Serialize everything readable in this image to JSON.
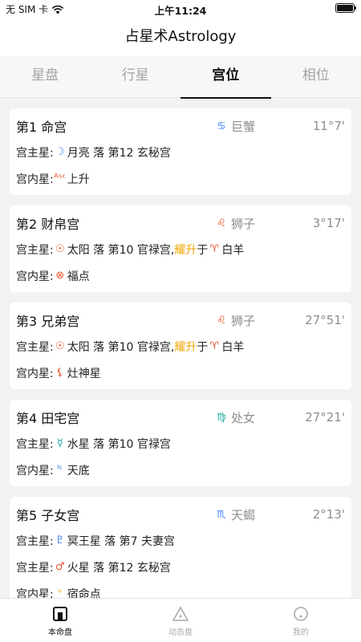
{
  "status": {
    "carrier": "无 SIM 卡",
    "time": "上午11:24"
  },
  "app": {
    "title": "占星术Astrology"
  },
  "tabs": [
    {
      "label": "星盘"
    },
    {
      "label": "行星"
    },
    {
      "label": "宫位"
    },
    {
      "label": "相位"
    }
  ],
  "active_tab": "宫位",
  "labels": {
    "ruler": "宫主星:",
    "inner": "宫内星:",
    "rise": "耀升",
    "rise_to": "于"
  },
  "houses": [
    {
      "name": "第1 命宫",
      "sign": "巨蟹",
      "sign_glyph": "♋",
      "degree": "11°7'",
      "ruler": {
        "glyph": "☽",
        "text": "月亮 落 第12 玄秘宫"
      },
      "inner": {
        "glyph": "ᴬˢᶜ",
        "text": "上升"
      }
    },
    {
      "name": "第2 财帛宫",
      "sign": "狮子",
      "sign_glyph": "♌",
      "degree": "3°17'",
      "ruler": {
        "glyph": "☉",
        "text": "太阳 落 第10 官禄宫,",
        "rise": true,
        "rise_glyph": "♈",
        "rise_sign": "白羊"
      },
      "inner": {
        "glyph": "⊗",
        "text": "福点"
      }
    },
    {
      "name": "第3 兄弟宫",
      "sign": "狮子",
      "sign_glyph": "♌",
      "degree": "27°51'",
      "ruler": {
        "glyph": "☉",
        "text": "太阳 落 第10 官禄宫,",
        "rise": true,
        "rise_glyph": "♈",
        "rise_sign": "白羊"
      },
      "inner": {
        "glyph": "⚸",
        "text": "灶神星"
      }
    },
    {
      "name": "第4 田宅宫",
      "sign": "处女",
      "sign_glyph": "♍",
      "degree": "27°21'",
      "ruler": {
        "glyph": "☿",
        "text": "水星 落 第10 官禄宫"
      },
      "inner": {
        "glyph": "ᴵᶜ",
        "text": "天底"
      }
    },
    {
      "name": "第5 子女宫",
      "sign": "天蝎",
      "sign_glyph": "♏",
      "degree": "2°13'",
      "ruler": {
        "glyph": "♇",
        "text": "冥王星 落 第7 夫妻宫"
      },
      "ruler2": {
        "glyph": "♂",
        "text": "火星 落 第12 玄秘宫"
      },
      "inner": {
        "glyph": "ᵛ",
        "text": "宿命点"
      }
    }
  ],
  "bottom_tabs": [
    {
      "label": "本命盘",
      "icon": "home-icon"
    },
    {
      "label": "动态盘",
      "icon": "triangle-icon"
    },
    {
      "label": "我的",
      "icon": "user-icon"
    }
  ],
  "colors": {
    "accent": "#111111",
    "rise": "#f0a500",
    "fire": "#e8502a",
    "water": "#3b82f6",
    "earth": "#1aa8a0"
  }
}
